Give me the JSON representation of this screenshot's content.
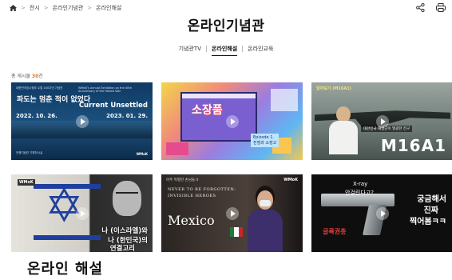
{
  "breadcrumb": {
    "home_icon": "home-icon",
    "items": [
      "전시",
      "온라인기념관",
      "온라인해설"
    ]
  },
  "tools": {
    "share_icon": "share-icon",
    "print_icon": "print-icon"
  },
  "page": {
    "title": "온라인기념관"
  },
  "tabs": [
    {
      "label": "기념관TV",
      "active": false
    },
    {
      "label": "온라인해설",
      "active": true
    },
    {
      "label": "온라인교육",
      "active": false
    }
  ],
  "listing": {
    "count_prefix": "총 게시물",
    "count": "30",
    "count_suffix": "건"
  },
  "cards": [
    {
      "small_left": "대한민국임시정부 수립 100주년 기념전",
      "small_right": "WMoK's Annual Exhibition on the 40th Anniversary of the Hallow War",
      "title_ko": "파도는 멈춘 적이 없었다",
      "title_en": "Current Unsettled",
      "date_start": "2022. 10. 26.",
      "date_end": "2023. 01. 29.",
      "caption": "전쟁기념관 기획전시실",
      "logo": "WMoK"
    },
    {
      "logo_text": "소장품",
      "episode": "Episode 1.",
      "episode_title": "전쟁과 소장고"
    },
    {
      "tag": "알아보기 (M16A1)",
      "subtitle": "대한민국 해병군이 열광한 전구",
      "big": "M16A1"
    },
    {
      "logo": "WMoK",
      "line1": "나 (이스라엘)와",
      "line2": "나 (한민국)의",
      "line3": "연결고리"
    },
    {
      "kicker": "아주 특별한 손님들 II",
      "logo": "WMoK",
      "line1": "NEVER TO BE FORGOTTEN:",
      "line2": "INVISIBLE HEROES",
      "country": "Mexico"
    },
    {
      "q1": "X-ray",
      "q2": "안걸린다고?",
      "red": "글록권총",
      "r1": "궁금해서",
      "r2": "진짜",
      "r3": "찍어봄ㅋㅋ"
    }
  ],
  "section": {
    "title": "온라인 해설"
  },
  "colors": {
    "accent": "#d8782a",
    "mexico_green": "#1f7a3b",
    "mexico_red": "#c4282d"
  }
}
